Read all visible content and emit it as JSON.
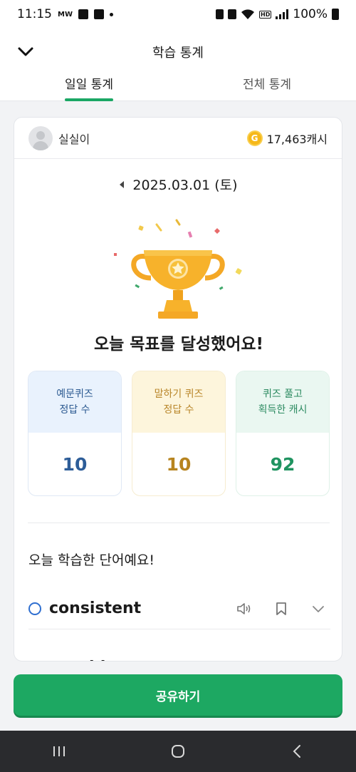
{
  "status_bar": {
    "time": "11:15",
    "small_label": "MW",
    "battery_pct": "100%"
  },
  "header": {
    "title": "학습 통계",
    "tabs": [
      {
        "label": "일일 통계",
        "active": true
      },
      {
        "label": "전체 통계",
        "active": false
      }
    ]
  },
  "profile": {
    "username": "실실이",
    "coin_glyph": "G",
    "cash": "17,463캐시"
  },
  "date": "2025.03.01 (토)",
  "goal_message": "오늘 목표를 달성했어요!",
  "stats": [
    {
      "label": "예문퀴즈\n정답 수",
      "value": "10",
      "color": "#2d5d98"
    },
    {
      "label": "말하기 퀴즈\n정답 수",
      "value": "10",
      "color": "#b7841f"
    },
    {
      "label": "퀴즈 풀고\n획득한 캐시",
      "value": "92",
      "color": "#1f9360"
    }
  ],
  "words_section": {
    "title": "오늘 학습한 단어예요!",
    "words": [
      {
        "word": "consistent"
      },
      {
        "word": "provide"
      }
    ]
  },
  "share_button": "공유하기",
  "colors": {
    "accent": "#1da862",
    "radio": "#2f6fd0"
  }
}
